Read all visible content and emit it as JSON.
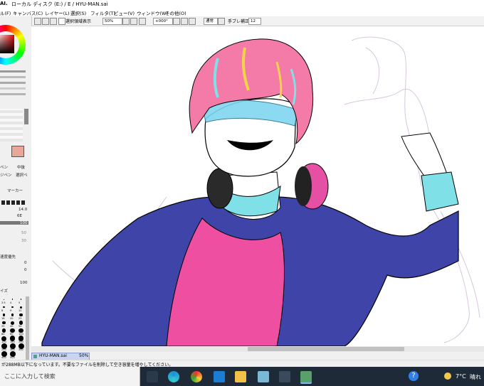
{
  "window": {
    "title": "ローカル ディスク (E:) / E / HYU-MAN.sai",
    "app_glyph": "AI."
  },
  "menu": [
    "ル(F)",
    "キャンバス(C)",
    "レイヤー(L)",
    "選択(S)",
    "フィルタ(T)",
    "ビュー(V)",
    "ウィンドウ(W)",
    "その他(O)"
  ],
  "toolbar": {
    "selection_display_label": "選択領域表示",
    "zoom": "50%",
    "rotation": "+000°",
    "blend_mode": "通常",
    "stabilizer_label": "手ブレ補正",
    "stabilizer_value": "12"
  },
  "left_panel": {
    "tool_labels": [
      "ペン",
      "中抜",
      "ジペン",
      "選択ペ",
      "マーカー"
    ],
    "brush_size": "14.0",
    "brush_size_min": "6E",
    "density": "100",
    "max_size_a": "50",
    "max_size_b": "30",
    "quality_label": "速度優先",
    "field_a": "0",
    "field_b": "0",
    "field_c": "100",
    "size_label": "イズ",
    "size_presets": [
      "3.5",
      "4",
      "5",
      "8",
      "9",
      "12",
      "16",
      "20",
      "25",
      "35",
      "40",
      "50",
      "60",
      "80",
      "100",
      "120",
      "160",
      "200",
      "250",
      "300",
      "350",
      "400",
      "500"
    ]
  },
  "canvas_tab": {
    "name": "HYU-MAN.sai",
    "zoom": "50%"
  },
  "status": {
    "message": "が288MB以下になっています。不要なファイルを削除して空き容量を増やしてください。"
  },
  "taskbar": {
    "search_placeholder": "ここに入力して検索",
    "weather_temp": "7°C",
    "weather_text": "晴れ",
    "help_glyph": "?"
  },
  "colors": {
    "hair": "#f47aa8",
    "jacket": "#3f45a8",
    "shirt": "#ee4fa0",
    "cuff": "#7fe0e8",
    "visor": "#7fd6f0"
  }
}
